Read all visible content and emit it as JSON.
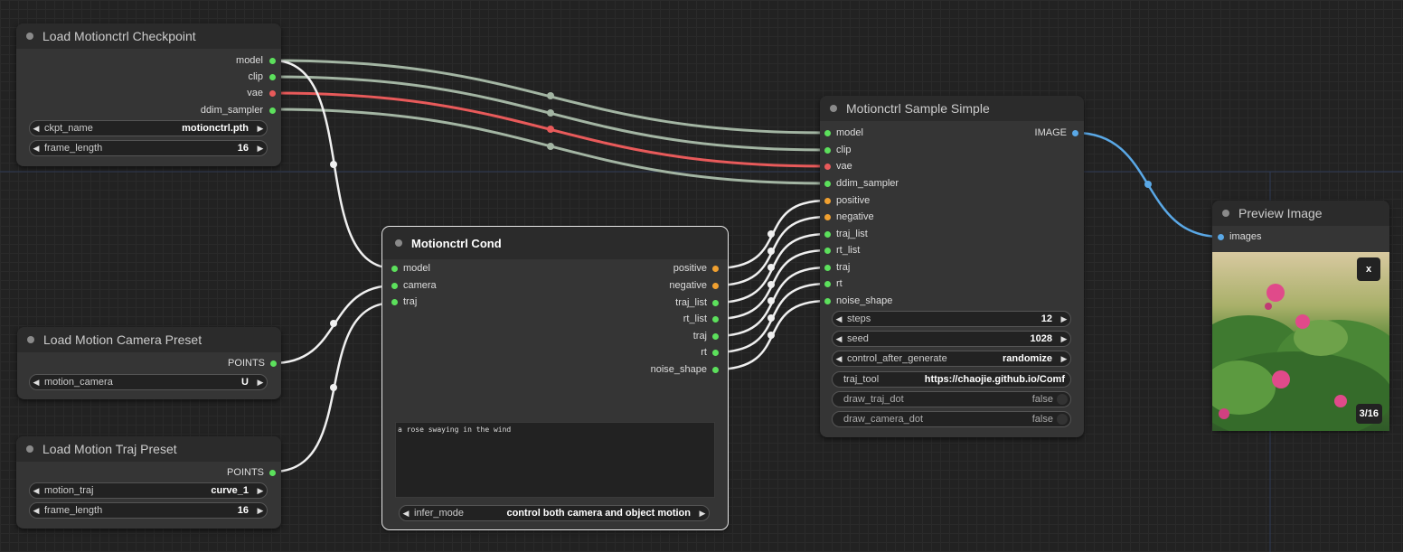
{
  "colors": {
    "canvas": "#222222",
    "node_bg": "#353535",
    "wire_model": "#a3b5a3",
    "wire_vae": "#e85a5a",
    "wire_image": "#5aa8e6",
    "wire_white": "#f0f0f0",
    "dot_green": "#5ce05c",
    "dot_red": "#e85a5a",
    "dot_orange": "#f0a030",
    "dot_blue": "#5aa8e6"
  },
  "checkpoint": {
    "title": "Load Motionctrl Checkpoint",
    "outputs": [
      "model",
      "clip",
      "vae",
      "ddim_sampler"
    ],
    "ckpt_label": "ckpt_name",
    "ckpt_value": "motionctrl.pth",
    "frame_label": "frame_length",
    "frame_value": "16"
  },
  "camera_preset": {
    "title": "Load Motion Camera Preset",
    "output": "POINTS",
    "label": "motion_camera",
    "value": "U"
  },
  "traj_preset": {
    "title": "Load Motion Traj Preset",
    "output": "POINTS",
    "traj_label": "motion_traj",
    "traj_value": "curve_1",
    "frame_label": "frame_length",
    "frame_value": "16"
  },
  "cond": {
    "title": "Motionctrl Cond",
    "inputs": [
      "model",
      "camera",
      "traj"
    ],
    "outputs": [
      "positive",
      "negative",
      "traj_list",
      "rt_list",
      "traj",
      "rt",
      "noise_shape"
    ],
    "prompt": "a rose swaying in the wind",
    "infer_label": "infer_mode",
    "infer_value": "control both camera and object motion"
  },
  "sampler": {
    "title": "Motionctrl Sample Simple",
    "inputs": [
      "model",
      "clip",
      "vae",
      "ddim_sampler",
      "positive",
      "negative",
      "traj_list",
      "rt_list",
      "traj",
      "rt",
      "noise_shape"
    ],
    "output": "IMAGE",
    "steps_label": "steps",
    "steps_value": "12",
    "seed_label": "seed",
    "seed_value": "1028",
    "cag_label": "control_after_generate",
    "cag_value": "randomize",
    "traj_tool_label": "traj_tool",
    "traj_tool_value": "https://chaojie.github.io/Comf",
    "draw_traj_label": "draw_traj_dot",
    "draw_traj_value": "false",
    "draw_camera_label": "draw_camera_dot",
    "draw_camera_value": "false"
  },
  "preview": {
    "title": "Preview Image",
    "input": "images",
    "close": "x",
    "counter": "3/16"
  }
}
